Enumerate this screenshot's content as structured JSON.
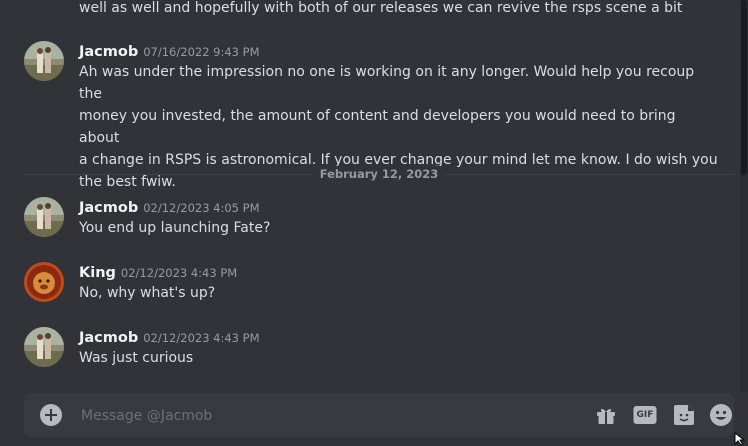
{
  "previous_message_tail": "well as well and hopefully with both of our releases we can revive the rsps scene a bit",
  "messages_top": [
    {
      "author": "Jacmob",
      "timestamp": "07/16/2022 9:43 PM",
      "lines": [
        "Ah was under the impression no one is working on it any longer. Would help you recoup the",
        "money you invested, the amount of content and developers you would need to bring about",
        "a change in RSPS is astronomical. If you ever change your mind let me know. I do wish you",
        "the best fwiw."
      ]
    }
  ],
  "date_divider": "February 12, 2023",
  "messages": [
    {
      "author": "Jacmob",
      "timestamp": "02/12/2023 4:05 PM",
      "text": "You end up launching Fate?",
      "avatar": "jacmob-avatar"
    },
    {
      "author": "King",
      "timestamp": "02/12/2023 4:43 PM",
      "text": "No, why what's up?",
      "avatar": "king-avatar"
    },
    {
      "author": "Jacmob",
      "timestamp": "02/12/2023 4:43 PM",
      "text": "Was just curious",
      "avatar": "jacmob-avatar"
    }
  ],
  "composer": {
    "placeholder": "Message @Jacmob",
    "icons": [
      "add-icon",
      "gift-icon",
      "gif-icon",
      "sticker-icon",
      "emoji-icon"
    ],
    "gif_label": "GIF"
  },
  "colors": {
    "background": "#313338",
    "composer": "#383a40",
    "author": "#f2f3f5",
    "timestamp": "#949ba4"
  }
}
